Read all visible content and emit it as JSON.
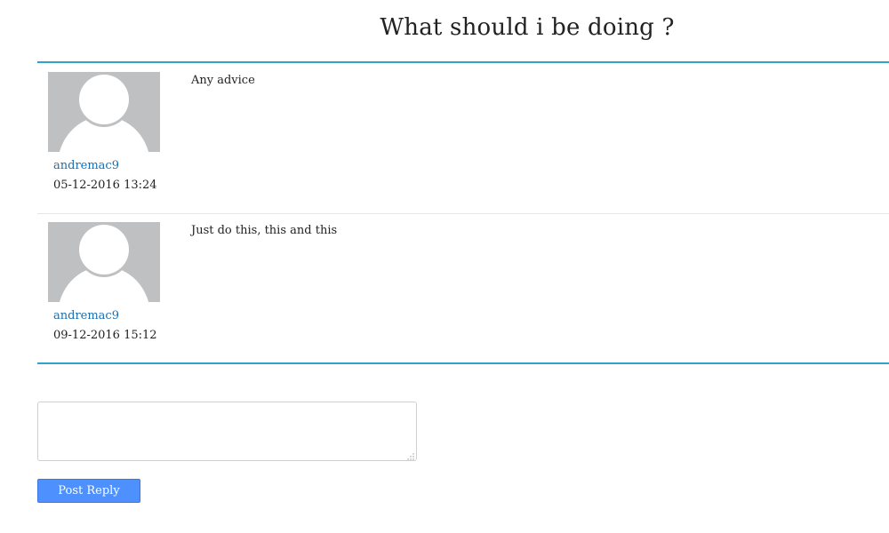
{
  "thread": {
    "title": "What should i be doing ?"
  },
  "posts": [
    {
      "author": "andremac9",
      "timestamp": "05-12-2016 13:24",
      "body": "Any advice",
      "avatar_icon": "default-user-silhouette-icon"
    },
    {
      "author": "andremac9",
      "timestamp": "09-12-2016 15:12",
      "body": "Just do this, this and this",
      "avatar_icon": "default-user-silhouette-icon"
    }
  ],
  "reply": {
    "textarea_value": "",
    "button_label": "Post Reply"
  },
  "colors": {
    "accent_border": "#2ea5c6",
    "link": "#1a6fb3",
    "button": "#4d90fe",
    "avatar_bg": "#bfc0c2"
  }
}
